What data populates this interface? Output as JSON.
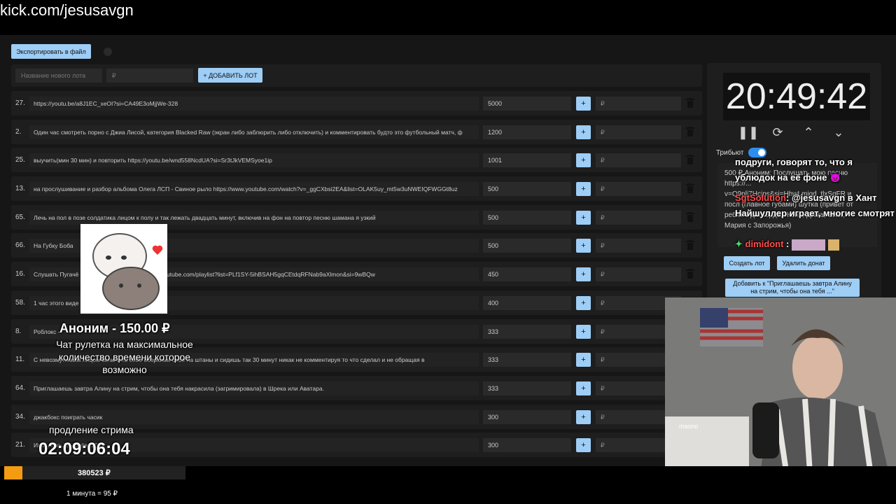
{
  "browser": {
    "url": "kick.com/jesusavgn"
  },
  "toolbar": {
    "export_label": "Экспортировать в файл"
  },
  "add_lot": {
    "name_placeholder": "Название нового лота",
    "amount_placeholder": "₽",
    "add_label": "+ ДОБАВИТЬ ЛОТ"
  },
  "lots": [
    {
      "num": "27.",
      "name": "https://youtu.be/a8J1EC_xeOI?si=CA49E3oMjjWe-328",
      "amount": "5000",
      "plus": "+",
      "rub": "₽"
    },
    {
      "num": "2.",
      "name": "Один час смотреть порно с Джиа Лисой, категория Blacked Raw (экран либо заблюрить либо отключить) и комментировать будто это футбольный матч, ф",
      "amount": "1200",
      "plus": "+",
      "rub": "₽"
    },
    {
      "num": "25.",
      "name": "выучить(мин 30 мин) и повторить https://youtu.be/wnd558NcdUA?si=Sr3tJkVEMSyoe1ip",
      "amount": "1001",
      "plus": "+",
      "rub": "₽"
    },
    {
      "num": "13.",
      "name": "на прослушивание и разбор альбома Олега ЛСП - Свиное рыло https://www.youtube.com/watch?v=_ggCXbsi2EA&list=OLAK5uy_mt5w3uNWEIQFWGGt8uz",
      "amount": "500",
      "plus": "+",
      "rub": "₽"
    },
    {
      "num": "65.",
      "name": "Лечь на пол в позе солдатика лицом к полу и так лежать двадцать минут, включив на фон на повтор песню шамана я узкий",
      "amount": "500",
      "plus": "+",
      "rub": "₽"
    },
    {
      "num": "66.",
      "name": "На Губку Боба",
      "amount": "500",
      "plus": "+",
      "rub": "₽"
    },
    {
      "num": "16.",
      "name": "Слушать Пугачё                          С маэстро. Плейлист: https://youtube.com/playlist?list=PLf1SY-5ihBSAH5gqCEtdqRFNab9aXlmon&si=9wBQw",
      "amount": "450",
      "plus": "+",
      "rub": "₽"
    },
    {
      "num": "58.",
      "name": "1 час этого виде                          ch?v=gd0K1XsFR6I",
      "amount": "400",
      "plus": "+",
      "rub": "₽"
    },
    {
      "num": "8.",
      "name": "Роблокс -",
      "amount": "333",
      "plus": "+",
      "rub": "₽"
    },
    {
      "num": "11.",
      "name": "С невозмутимым лицом включить себе боеркими себе на штаны и сидишь так 30 минут никак не комментируя то что сделал и не обращая в",
      "amount": "333",
      "plus": "+",
      "rub": "₽"
    },
    {
      "num": "64.",
      "name": "Приглашаешь завтра Алину на стрим, чтобы она тебя накрасила (загримировала) в Шрека или Аватара.",
      "amount": "333",
      "plus": "+",
      "rub": "₽"
    },
    {
      "num": "34.",
      "name": "джакбокс поиграть часик",
      "amount": "300",
      "plus": "+",
      "rub": "₽"
    },
    {
      "num": "21.",
      "name": "Игра Amo Jet Jupiter 2001",
      "amount": "300",
      "plus": "+",
      "rub": "₽"
    }
  ],
  "timer": {
    "time": "20:49:42"
  },
  "controls": {
    "pause": "❚❚",
    "sync": "⟳",
    "up": "⌃",
    "down": "⌄"
  },
  "tribute": {
    "label": "Трибьют"
  },
  "donate_panel": {
    "text": "500 ₽ Аноним: Послушать мою песню https://... v=Q9pli7Hcjps&si=HhwLmiqd_tlxSqFR и посл (главное губами) шутка (привет от ребят с дискорда, Женя, Дима, Олег, Мария с Запорожья)",
    "create_lot": "Создать лот",
    "delete_donate": "Удалить донат",
    "add_to": "Добавить к \"Приглашаешь завтра Алину на стрим, чтобы она тебя ...\""
  },
  "chat": [
    {
      "text": "подруги, говорят то, что я"
    },
    {
      "text": "ублюдок на её фоне 😈"
    },
    {
      "user": "SgtSolution",
      "text": ": @jesusavgn в Хант Найшуллер играет, многие смотрят"
    },
    {
      "user": "dimidont",
      "text": ":"
    }
  ],
  "alert": {
    "title": "Аноним - 150.00 ₽",
    "message": "Чат рулетка на максимальное количество времени которое возможно"
  },
  "stream_ext": {
    "label": "продление стрима",
    "time": "02:09:06:04"
  },
  "totals": {
    "sum": "380523 ₽",
    "rate": "1 минута = 95 ₽",
    "progress": 0.1
  },
  "colors": {
    "accent": "#9ecdf5",
    "progress": "#f39c12",
    "toggle": "#2e8ef0"
  }
}
